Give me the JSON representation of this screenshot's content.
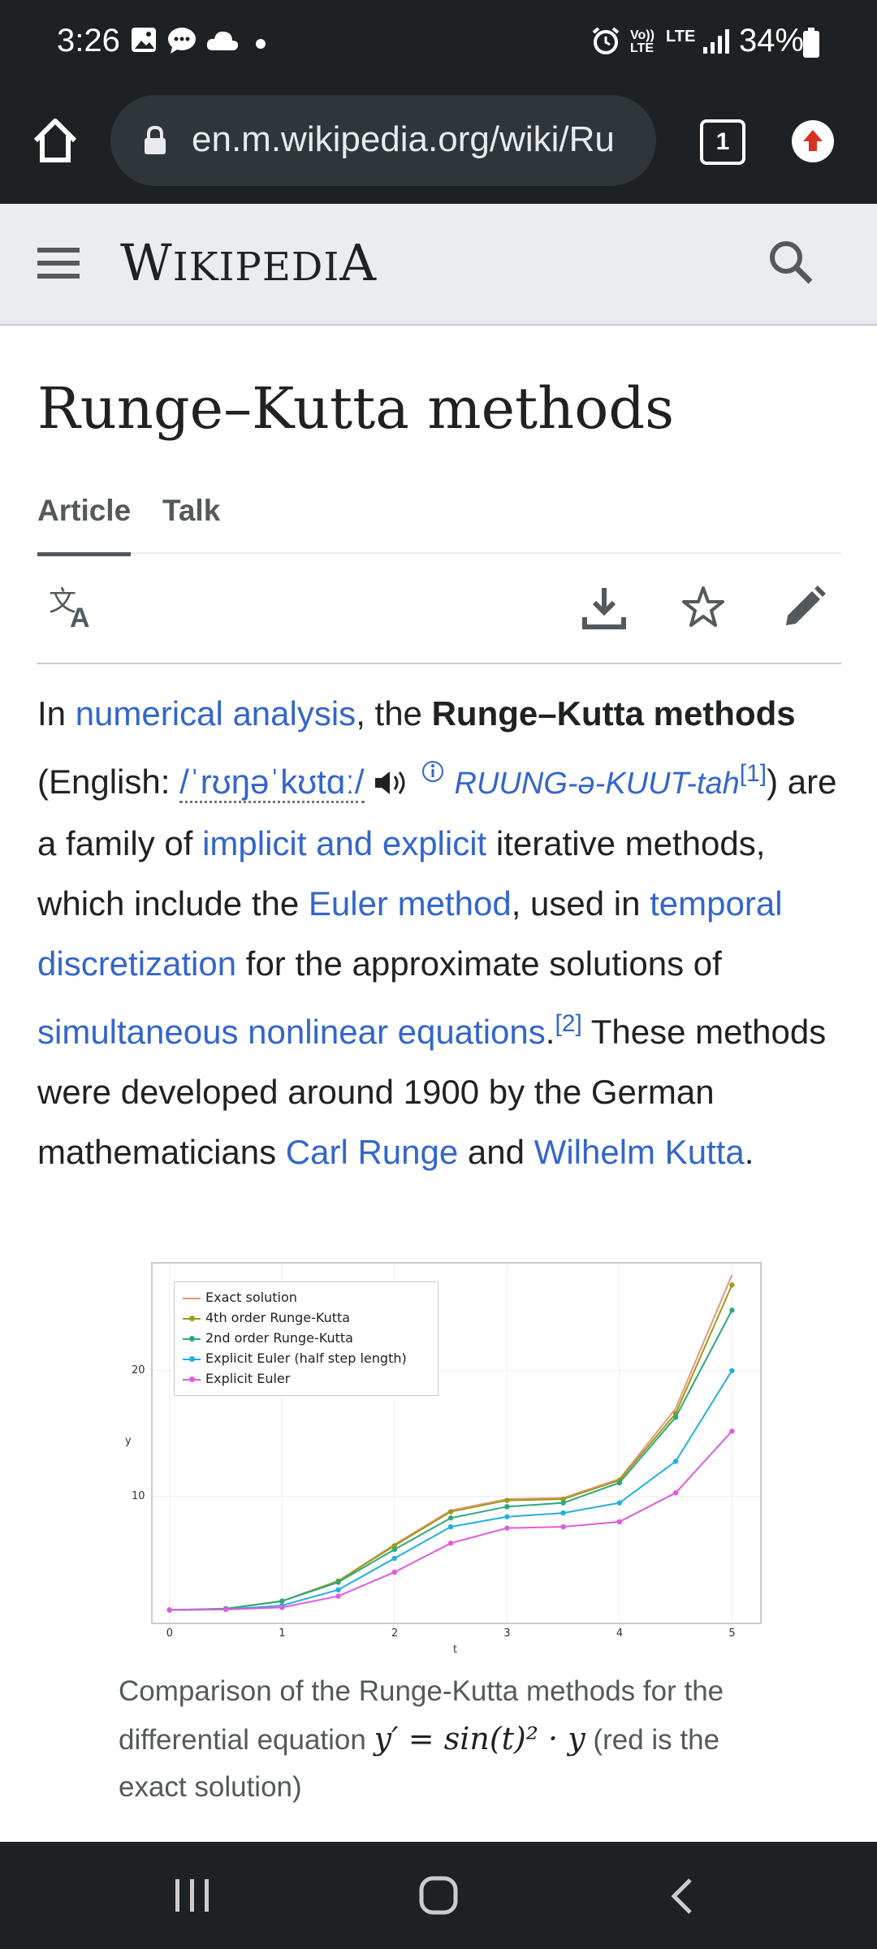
{
  "status_bar": {
    "time": "3:26",
    "network": "LTE",
    "battery": "34%"
  },
  "browser": {
    "url": "en.m.wikipedia.org/wiki/Ru",
    "tab_count": "1"
  },
  "wiki": {
    "logo_first": "W",
    "logo_mid": "IKIPEDI",
    "logo_last": "A",
    "title": "Runge–Kutta methods",
    "tabs": [
      "Article",
      "Talk"
    ],
    "paragraph": {
      "p1": "In ",
      "l1": "numerical analysis",
      "p2": ", the ",
      "bold": "Runge–Kutta methods",
      "p3": " (English: ",
      "ipa": "/ˈrʊŋəˈkʊtɑː/",
      "pron": "RUUNG-ə-KUUT-tah",
      "ref1": "[1]",
      "p4": ")",
      "p5": " are a family of ",
      "l2": "implicit and explicit",
      "p6": " iterative methods, which include the ",
      "l3": "Euler method",
      "p7": ", used in ",
      "l4": "temporal discretization",
      "p8": " for the approximate solutions of ",
      "l5": "simultaneous nonlinear equations",
      "p9": ".",
      "ref2": "[2]",
      "p10": " These methods were developed around 1900 by the German mathematicians ",
      "l6": "Carl Runge",
      "p11": " and ",
      "l7": "Wilhelm Kutta",
      "p12": "."
    },
    "caption": {
      "c1": "Comparison of the Runge-Kutta methods for the differential equation ",
      "eq": "y′ = sin(t)² · y",
      "c2": " (red is the exact solution)"
    }
  },
  "chart_data": {
    "type": "line",
    "xlabel": "t",
    "ylabel": "y",
    "xticks": [
      "0",
      "1",
      "2",
      "3",
      "4",
      "5"
    ],
    "yticks": [
      "10",
      "20"
    ],
    "xlim": [
      -0.15,
      5.25
    ],
    "ylim": [
      0,
      28.5
    ],
    "grid": true,
    "legend": "top-left",
    "x": [
      0,
      0.5,
      1,
      1.5,
      2,
      2.5,
      3,
      3.5,
      4,
      4.5,
      5
    ],
    "series": [
      {
        "name": "Exact solution",
        "color": "#e9967a",
        "values": [
          1,
          1.1,
          1.7,
          3.3,
          6.2,
          8.9,
          9.8,
          9.9,
          11.4,
          17,
          27.6
        ]
      },
      {
        "name": "4th order Runge-Kutta",
        "color": "#9c9b1a",
        "values": [
          1,
          1.1,
          1.7,
          3.3,
          6.1,
          8.8,
          9.7,
          9.8,
          11.3,
          16.6,
          26.8
        ]
      },
      {
        "name": "2nd order Runge-Kutta",
        "color": "#2ca87b",
        "values": [
          1,
          1.1,
          1.7,
          3.2,
          5.8,
          8.3,
          9.2,
          9.5,
          11.1,
          16.3,
          24.8
        ]
      },
      {
        "name": "Explicit Euler (half step length)",
        "color": "#24aee0",
        "values": [
          1,
          1.05,
          1.35,
          2.6,
          5.1,
          7.6,
          8.4,
          8.7,
          9.5,
          12.8,
          20
        ]
      },
      {
        "name": "Explicit Euler",
        "color": "#e15ae1",
        "values": [
          1,
          1.03,
          1.2,
          2.1,
          4,
          6.3,
          7.5,
          7.6,
          8,
          10.3,
          15.2
        ]
      }
    ]
  }
}
